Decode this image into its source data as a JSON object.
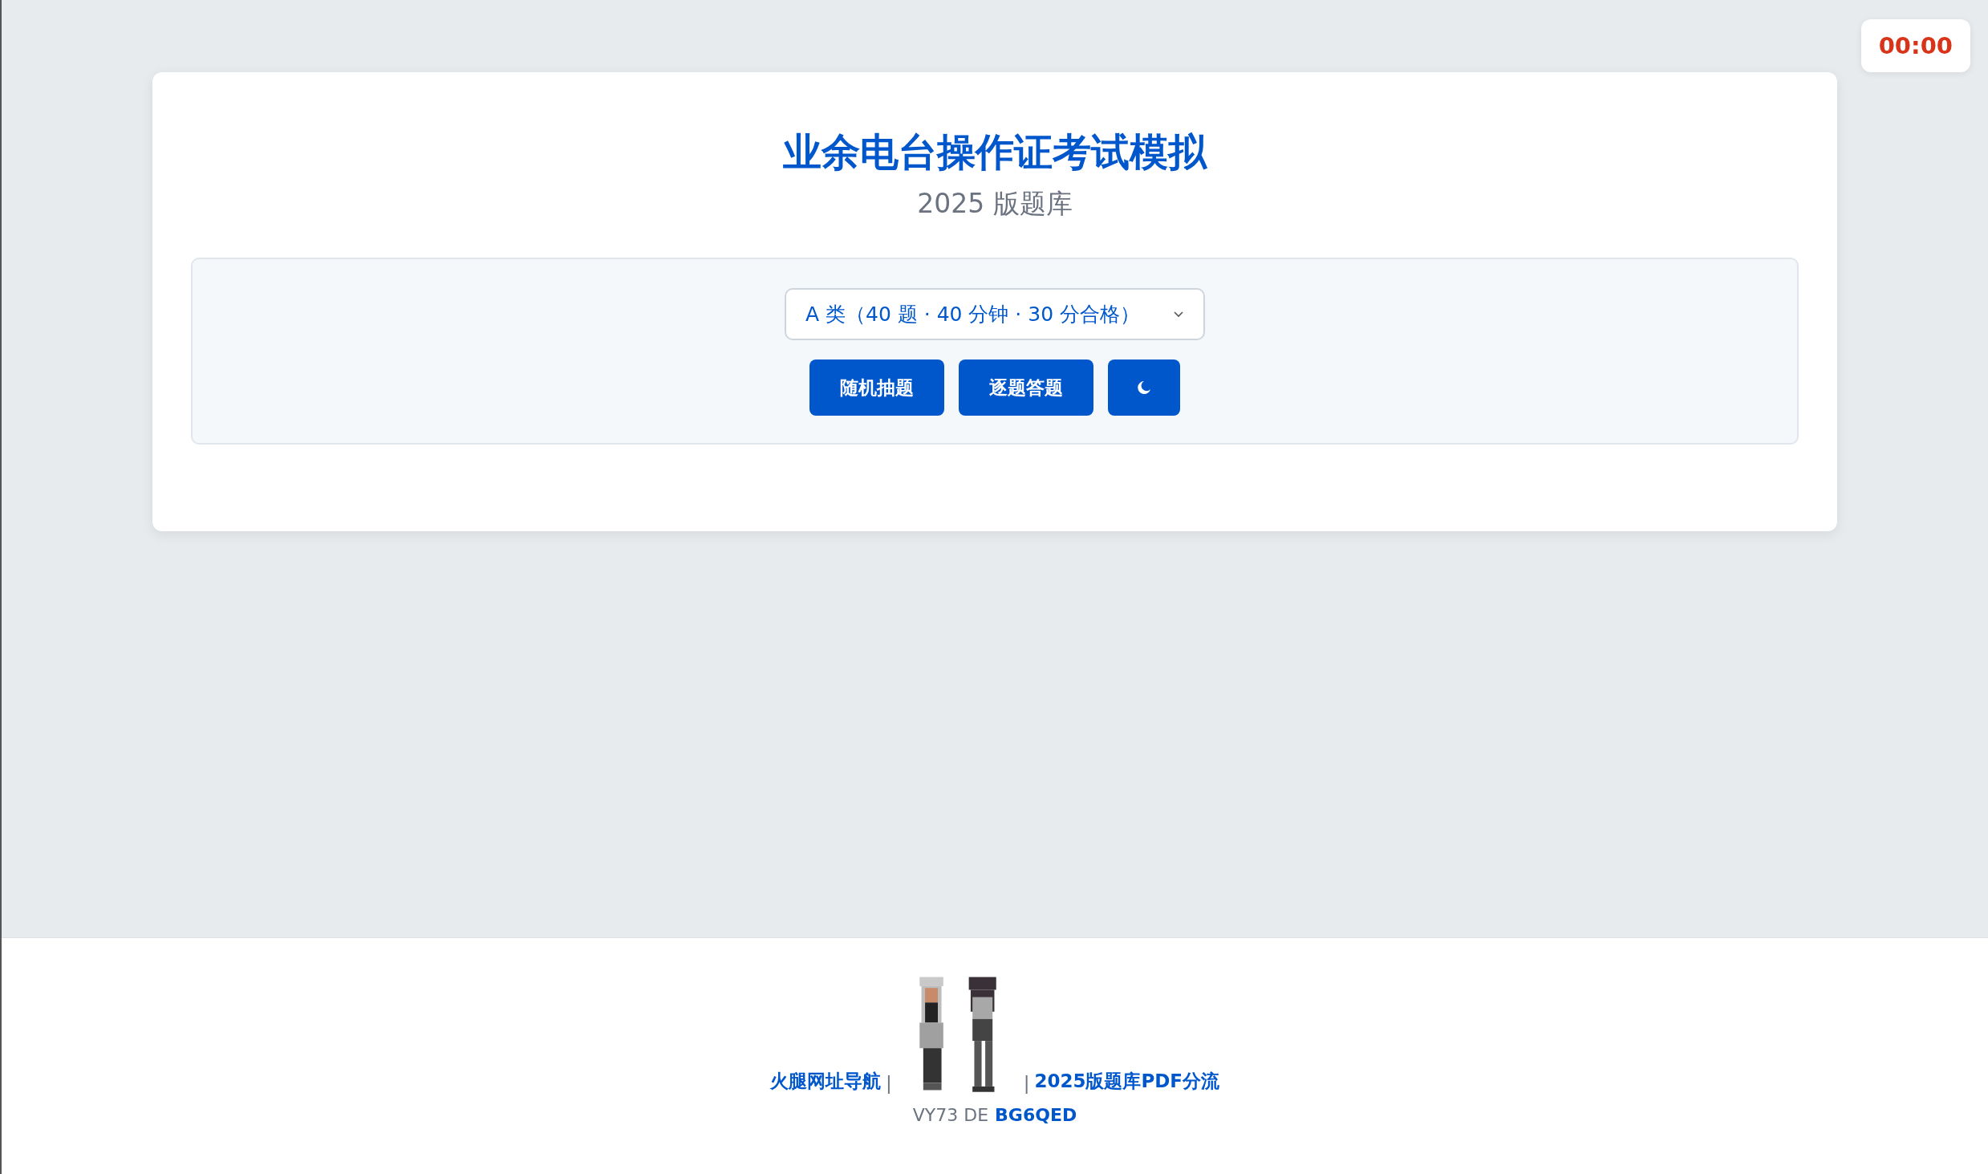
{
  "timer": "00:00",
  "title": "业余电台操作证考试模拟",
  "subtitle": "2025 版题库",
  "exam_select": {
    "value": "A 类（40 题 · 40 分钟 · 30 分合格）"
  },
  "buttons": [
    {
      "kind": "text",
      "label": "随机抽题"
    },
    {
      "kind": "text",
      "label": "逐题答题"
    },
    {
      "kind": "theme"
    }
  ],
  "footer": {
    "nav": [
      {
        "kind": "link",
        "text": "火腿网址导航"
      },
      {
        "kind": "separator",
        "text": "|"
      },
      {
        "kind": "image"
      },
      {
        "kind": "separator",
        "text": "|"
      },
      {
        "kind": "link",
        "text": "2025版题库PDF分流"
      }
    ],
    "signoff": "VY73 DE",
    "callsign": "BG6QED"
  }
}
